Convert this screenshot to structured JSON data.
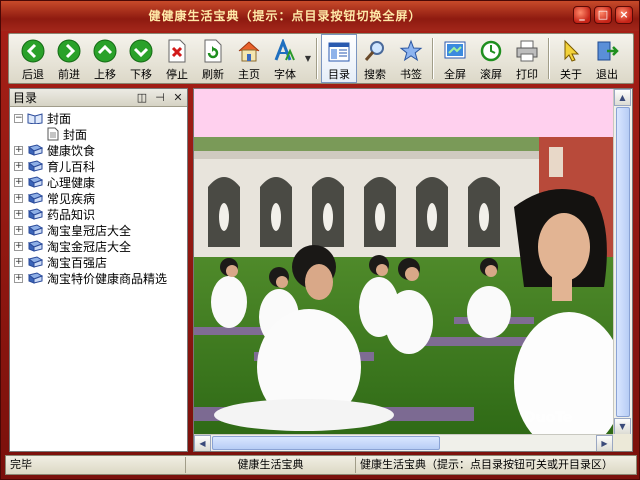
{
  "window": {
    "title": "健健康生活宝典（提示：点目录按钮切换全屏）",
    "controls": [
      "_",
      "□",
      "×"
    ]
  },
  "toolbar": {
    "buttons": [
      {
        "label": "后退",
        "icon": "back-arrow-icon"
      },
      {
        "label": "前进",
        "icon": "forward-arrow-icon"
      },
      {
        "label": "上移",
        "icon": "up-arrow-icon"
      },
      {
        "label": "下移",
        "icon": "down-arrow-icon"
      },
      {
        "label": "停止",
        "icon": "stop-icon"
      },
      {
        "label": "刷新",
        "icon": "refresh-icon"
      },
      {
        "label": "主页",
        "icon": "home-icon"
      },
      {
        "label": "字体",
        "icon": "font-icon"
      },
      {
        "label": "目录",
        "icon": "contents-icon"
      },
      {
        "label": "搜索",
        "icon": "search-icon"
      },
      {
        "label": "书签",
        "icon": "bookmark-star-icon"
      },
      {
        "label": "全屏",
        "icon": "fullscreen-icon"
      },
      {
        "label": "滚屏",
        "icon": "scroll-icon"
      },
      {
        "label": "打印",
        "icon": "printer-icon"
      },
      {
        "label": "关于",
        "icon": "about-cursor-icon"
      },
      {
        "label": "退出",
        "icon": "exit-icon"
      }
    ]
  },
  "sidebar": {
    "title": "目录",
    "tree": [
      {
        "label": "封面",
        "expander": "−",
        "children": [
          {
            "label": "封面"
          }
        ]
      },
      {
        "label": "健康饮食",
        "expander": "+"
      },
      {
        "label": "育儿百科",
        "expander": "+"
      },
      {
        "label": "心理健康",
        "expander": "+"
      },
      {
        "label": "常见疾病",
        "expander": "+"
      },
      {
        "label": "药品知识",
        "expander": "+"
      },
      {
        "label": "淘宝皇冠店大全",
        "expander": "+"
      },
      {
        "label": "淘宝金冠店大全",
        "expander": "+"
      },
      {
        "label": "淘宝百强店",
        "expander": "+"
      },
      {
        "label": "淘宝特价健康商品精选",
        "expander": "+"
      }
    ]
  },
  "status": {
    "left": "完毕",
    "middle": "健康生活宝典",
    "right": "健康生活宝典（提示：点目录按钮可关或开目录区）"
  },
  "colors": {
    "frame": "#a82017",
    "pink_band": "#ffd0ee",
    "title_text": "#ffe9a8"
  }
}
